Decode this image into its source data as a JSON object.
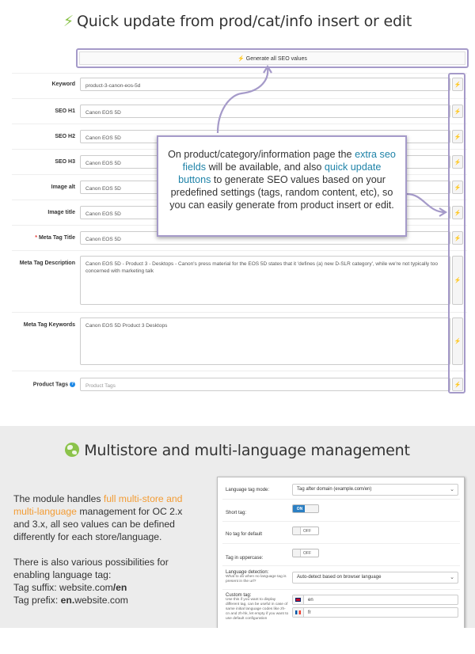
{
  "top": {
    "title": "Quick update from prod/cat/info insert or edit",
    "bolt_icon": "⚡",
    "generate_button": "⚡ Generate all SEO values",
    "rows": [
      {
        "label": "Keyword",
        "value": "product-3-canon-eos-5d",
        "required": false
      },
      {
        "label": "SEO H1",
        "value": "Canon EOS 5D",
        "required": false
      },
      {
        "label": "SEO H2",
        "value": "Canon EOS 5D",
        "required": false
      },
      {
        "label": "SEO H3",
        "value": "Canon EOS 5D",
        "required": false
      },
      {
        "label": "Image alt",
        "value": "Canon EOS 5D",
        "required": false
      },
      {
        "label": "Image title",
        "value": "Canon EOS 5D",
        "required": false
      },
      {
        "label": "Meta Tag Title",
        "value": "Canon EOS 5D",
        "required": true
      },
      {
        "label": "Meta Tag Description",
        "value": "Canon EOS 5D - Product 3 - Desktops - Canon's press material for the EOS 5D states that it 'defines (a) new D-SLR category', while we're not typically too concerned with marketing talk",
        "required": false
      },
      {
        "label": "Meta Tag Keywords",
        "value": "Canon EOS 5D Product 3 Desktops",
        "required": false
      },
      {
        "label": "Product Tags",
        "value": "",
        "placeholder": "Product Tags",
        "required": false,
        "help": true
      }
    ],
    "row_button_icon": "⚡",
    "callout": {
      "part1": "On product/category/information page the ",
      "hl1": "extra seo fields",
      "part2": " will be available, and also ",
      "hl2": "quick update buttons",
      "part3": " to generate SEO values based on your predefined settings (tags, random content, etc), so you can easily generate from product insert or edit."
    },
    "highlight_color": "#a59ac9",
    "link_color": "#1f83a8"
  },
  "bottom": {
    "title": "Multistore and multi-language management",
    "desc": {
      "p1_a": "The module handles ",
      "p1_hl": "full multi-store and multi-language",
      "p1_b": " management for OC 2.x and 3.x, all seo values can be defined differently for each store/language.",
      "p2_a": "There is also various possibilities for enabling language tag:",
      "suffix_label": "Tag suffix: website.com",
      "suffix_bold": "/en",
      "prefix_label": "Tag prefix: ",
      "prefix_bold": "en.",
      "prefix_rest": "website.com"
    },
    "accent_color": "#f39c34",
    "panel": {
      "lang_tag_mode_label": "Language tag mode:",
      "lang_tag_mode_value": "Tag after domain (example.com/en)",
      "short_tag_label": "Short tag:",
      "short_tag_state": "ON",
      "no_tag_default_label": "No tag for default",
      "no_tag_default_state": "OFF",
      "uppercase_label": "Tag in uppercase:",
      "uppercase_state": "OFF",
      "detection_label": "Language detection:",
      "detection_sub": "What to do when no language tag is present in the url?",
      "detection_value": "Auto-detect based on browser language",
      "custom_label": "Custom tag:",
      "custom_sub": "Use this if you want to display different tag, can be useful in case of same initial language codes like zh-cn and zh-hk, let empty if you want to use default configuration",
      "custom_values": [
        "en",
        "fr"
      ]
    }
  }
}
